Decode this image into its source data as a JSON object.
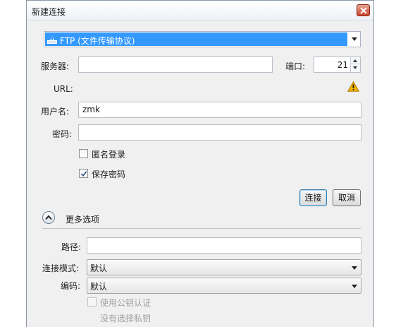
{
  "window": {
    "title": "新建连接"
  },
  "protocol": {
    "selected": "FTP (文件传输协议)"
  },
  "server": {
    "label": "服务器:",
    "value": ""
  },
  "port": {
    "label": "端口:",
    "value": "21"
  },
  "url": {
    "label": "URL:"
  },
  "username": {
    "label": "用户名:",
    "value": "zmk"
  },
  "password": {
    "label": "密码:",
    "value": ""
  },
  "options": {
    "anonymous_label": "匿名登录",
    "anonymous_checked": false,
    "save_password_label": "保存密码",
    "save_password_checked": true
  },
  "buttons": {
    "connect": "连接",
    "cancel": "取消"
  },
  "more": {
    "label": "更多选项",
    "path_label": "路径:",
    "path_value": "",
    "connect_mode_label": "连接模式:",
    "connect_mode_value": "默认",
    "encoding_label": "编码:",
    "encoding_value": "默认",
    "public_key_label": "使用公钥认证",
    "public_key_checked": false,
    "no_private_key": "没有选择私钥"
  },
  "icons": {
    "close": "close-icon",
    "ftp": "ftp-drive-icon",
    "warning": "warning-icon",
    "expander": "chevron-up-icon",
    "checkmark": "checkmark-icon"
  },
  "colors": {
    "selection": "#3399ff",
    "warning": "#f4b400",
    "close_button": "#c8452d"
  }
}
